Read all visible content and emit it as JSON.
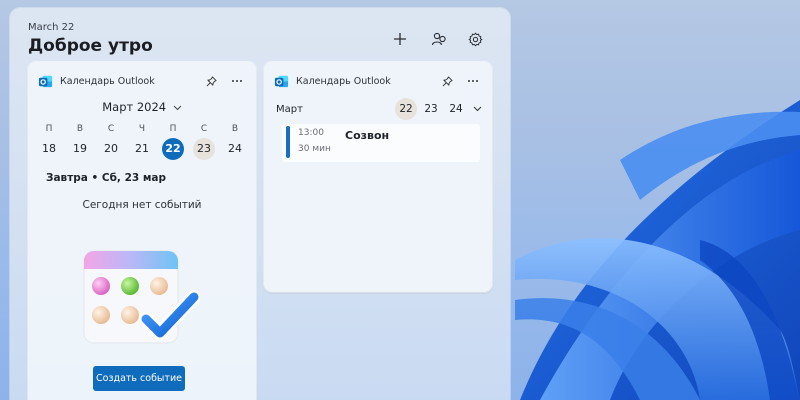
{
  "board": {
    "date_label": "March 22",
    "greeting": "Доброе утро",
    "add_icon": "plus-icon",
    "people_icon": "people-icon",
    "settings_icon": "gear-icon"
  },
  "calendar_left": {
    "app_title": "Календарь Outlook",
    "app_icon": "outlook-icon",
    "month_selector": "Март 2024",
    "weekday_names": [
      "П",
      "В",
      "С",
      "Ч",
      "П",
      "С",
      "В"
    ],
    "day_numbers": [
      "18",
      "19",
      "20",
      "21",
      "22",
      "23",
      "24"
    ],
    "today": "22",
    "selected": "23",
    "tomorrow_heading": "Завтра • Сб, 23 мар",
    "empty_text": "Сегодня нет событий",
    "create_button": "Создать событие"
  },
  "calendar_right": {
    "app_title": "Календарь Outlook",
    "app_icon": "outlook-icon",
    "month": "Март",
    "days": [
      "22",
      "23",
      "24"
    ],
    "selected": "22",
    "event": {
      "time": "13:00",
      "duration": "30 мин",
      "title": "Созвон"
    }
  },
  "colors": {
    "accent": "#0f6cbd",
    "event_bar": "#1a6dc0",
    "selected_day_bg": "#e7e2dc"
  }
}
